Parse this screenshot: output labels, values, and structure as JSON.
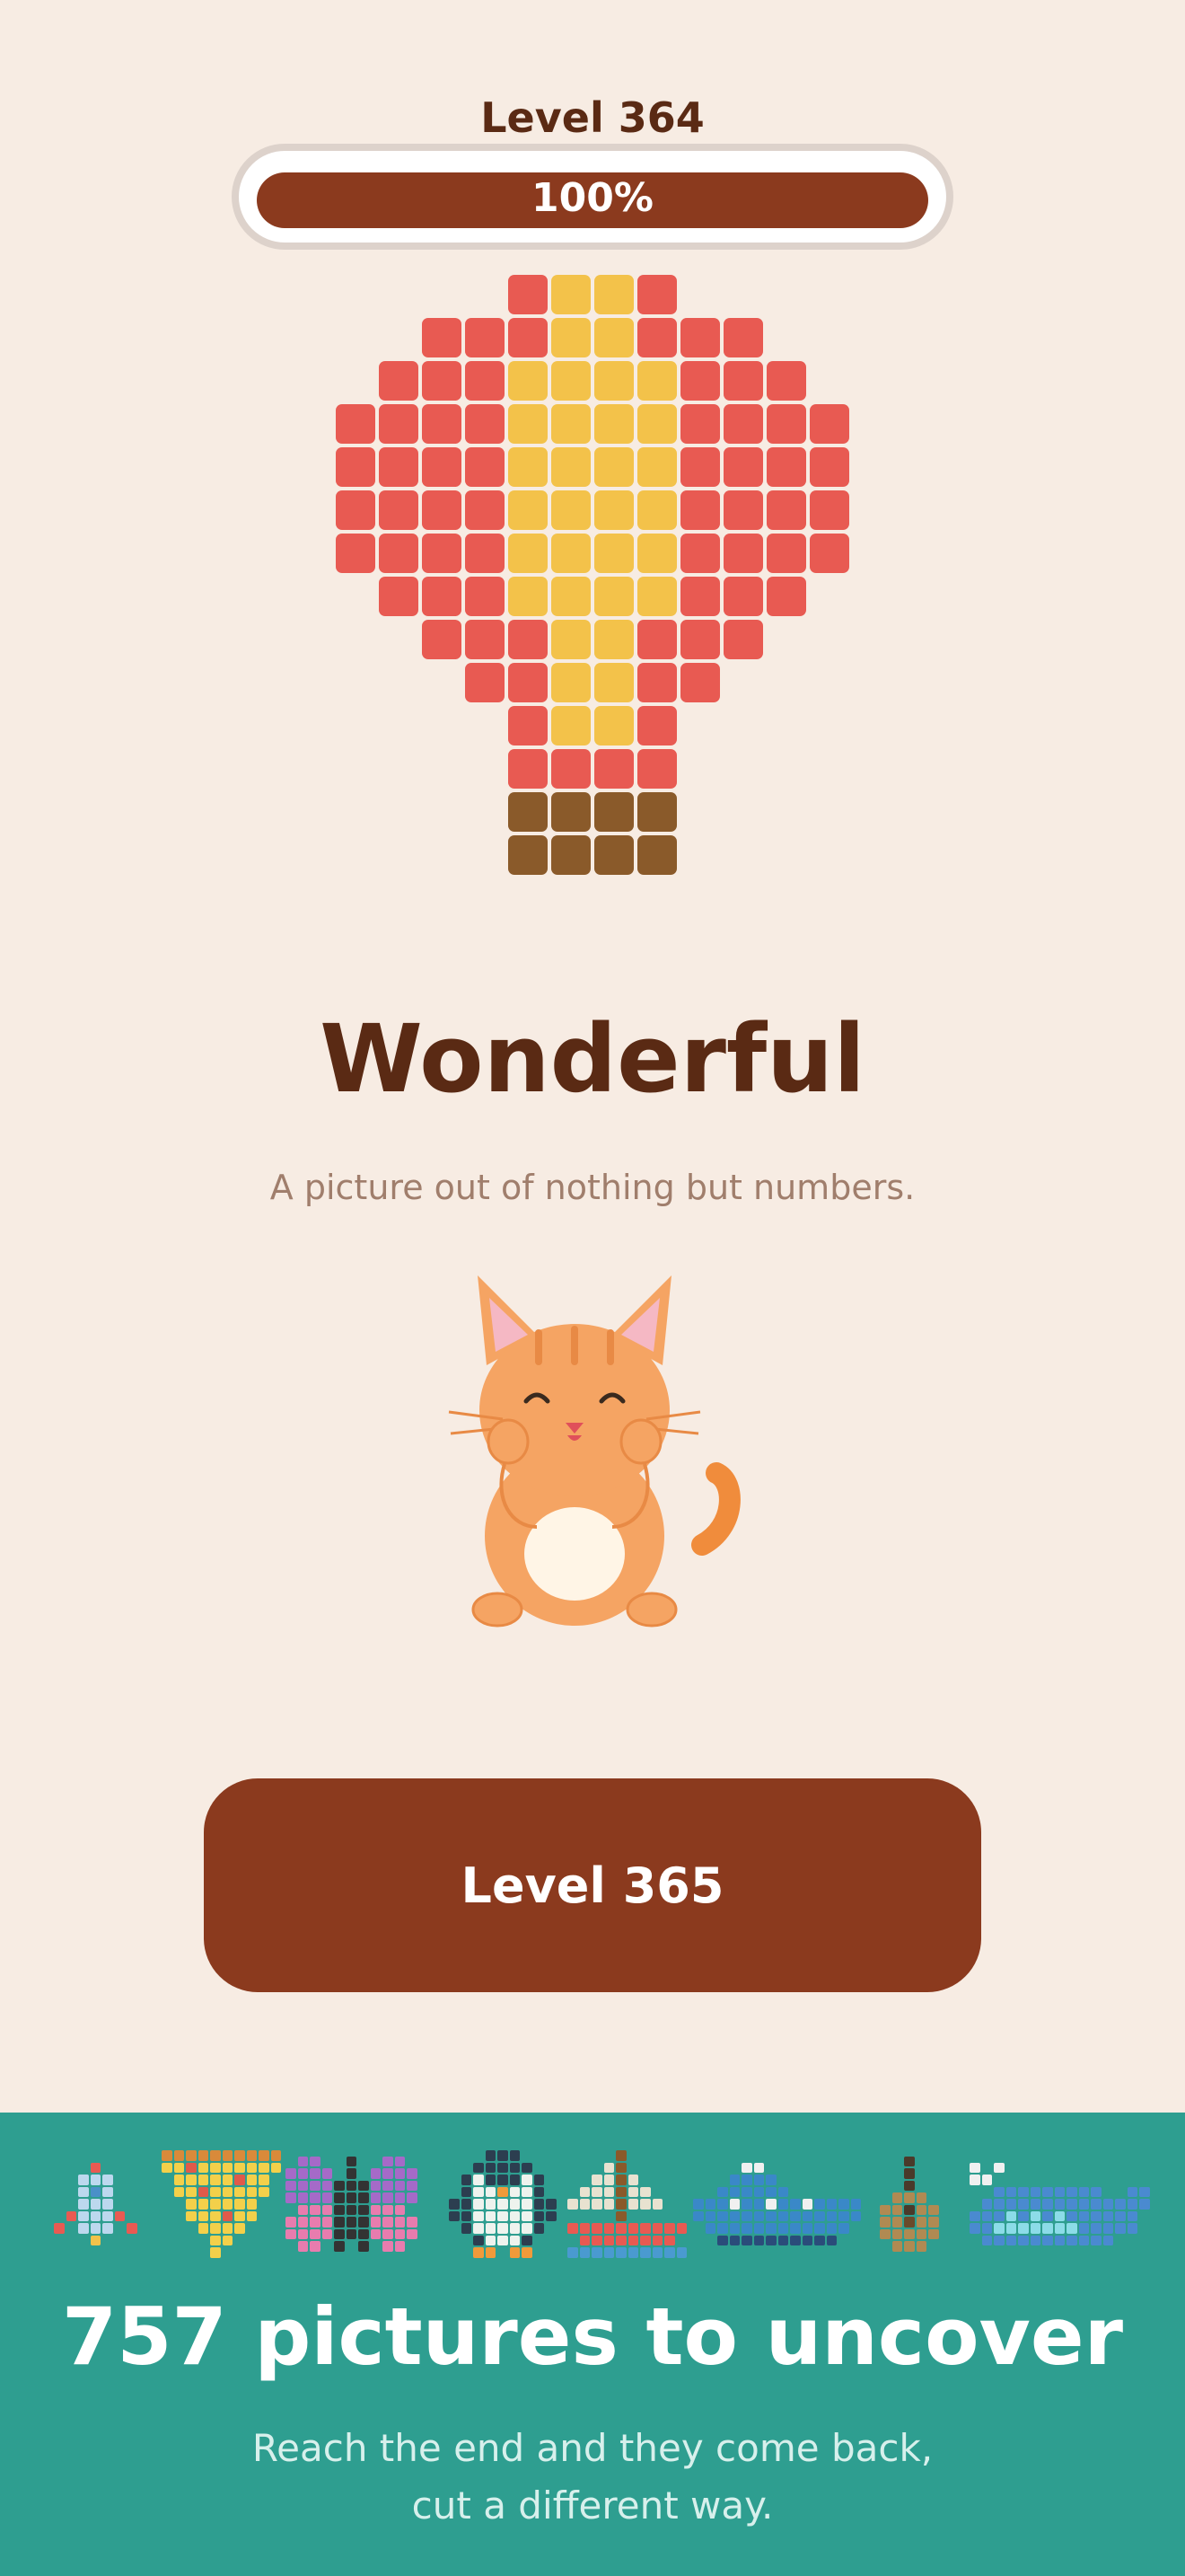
{
  "header": {
    "level_label": "Level 364",
    "progress_label": "100%",
    "progress_value": 1.0
  },
  "puzzle": {
    "name": "hot-air-balloon",
    "colors": {
      "R": "#e85a52",
      "Y": "#f3c24a",
      "B": "#8a5a2a"
    },
    "rows": [
      "....RYYR....",
      "..RRRYYRRR..",
      ".RRRYYYYRRR.",
      "RRRRYYYYRRRR",
      "RRRRYYYYRRRR",
      "RRRRYYYYRRRR",
      "RRRRYYYYRRRR",
      ".RRRYYYYRRR.",
      "..RRRYYRRR..",
      "...RRYYRR...",
      "....RYYR....",
      "....RRRR....",
      "....BBBB....",
      "....BBBB...."
    ]
  },
  "result": {
    "title": "Wonderful",
    "subtitle": "A picture out of nothing but numbers.",
    "mascot": "smiling-cat-icon"
  },
  "next_button": {
    "label": "Level 365"
  },
  "promo": {
    "background": "#2e9e90",
    "title": "757 pictures to uncover",
    "subtitle_lines": [
      "Reach the end and they come back,",
      "cut a different way."
    ],
    "thumbnails": [
      {
        "name": "rocket",
        "colors": {
          "r": "#e85a52",
          "b": "#bcd8ee",
          "d": "#4a90c8",
          "y": "#f3c24a"
        },
        "rows": [
          "...r...",
          "..bbb..",
          "..bdb..",
          "..bbb..",
          ".rbbbr.",
          "r.bbb.r",
          "...y..."
        ]
      },
      {
        "name": "pizza-slice",
        "colors": {
          "c": "#d98a3a",
          "y": "#f3d04a",
          "r": "#e05a4a"
        },
        "rows": [
          "cccccccccc",
          "yyryyyyyyy",
          ".yyyyyryy.",
          ".yyryyyyy.",
          "..yyyyyy..",
          "..yyyryy..",
          "...yyyy...",
          "....yy....",
          "....y....."
        ]
      },
      {
        "name": "butterfly",
        "colors": {
          "p": "#a56ac8",
          "k": "#333333",
          "i": "#e87cae"
        },
        "rows": [
          ".pp..k..pp.",
          "pppp.k.pppp",
          "ppppkkkpppp",
          "ppppkkkpppp",
          ".iiikkkiii.",
          "iiiikkkiiii",
          "iiiikkkiiii",
          ".ii.k.k.ii."
        ]
      },
      {
        "name": "penguin",
        "colors": {
          "k": "#2c3e50",
          "w": "#eef3ee",
          "o": "#f09a3a"
        },
        "rows": [
          "...kkk...",
          "..kkkkk..",
          ".kwkkkwk.",
          ".kwwowwk.",
          "kkwwwwwkk",
          "kkwwwwwkk",
          ".kwwwwwk.",
          "..kwwwk..",
          "..oo.oo.."
        ]
      },
      {
        "name": "sailboat",
        "colors": {
          "w": "#e8e2d0",
          "b": "#8a5a2a",
          "r": "#e85a52",
          "l": "#4a9ad0"
        },
        "rows": [
          "....b.....",
          "...wb.....",
          "..wwbw....",
          ".wwwbww...",
          "wwwwbwww..",
          "....b.....",
          "rrrrrrrrrr",
          ".rrrrrrrr.",
          "llllllllll"
        ]
      },
      {
        "name": "ship",
        "colors": {
          "w": "#f0f0f0",
          "b": "#3a88c8",
          "d": "#2a4c7a"
        },
        "rows": [
          "....ww........",
          "...bbbb.......",
          "..bbbbbb......",
          "bbbwbbwbbwbbbb",
          "bbbbbbbbbbbbbb",
          ".bbbbbbbbbbbb.",
          "..dddddddddd.."
        ]
      },
      {
        "name": "lute",
        "colors": {
          "k": "#4a3a2a",
          "t": "#b08a52",
          "d": "#6a4a2a"
        },
        "rows": [
          "..k..",
          "..k..",
          "..k..",
          ".ttt.",
          "ttktt",
          "ttdtt",
          "ttttt",
          ".ttt."
        ]
      },
      {
        "name": "whale",
        "colors": {
          "w": "#f0f0f0",
          "b": "#4a8ad0",
          "c": "#8cdce8"
        },
        "rows": [
          "w.w............",
          "ww.............",
          "..bbbbbbbbb..bb",
          ".bbbbbbbbbbbbbb",
          "bbbcbcbcbbbbbb.",
          "bbcccccccbbbbb.",
          ".bbbbbbbbbbb..."
        ]
      }
    ]
  }
}
